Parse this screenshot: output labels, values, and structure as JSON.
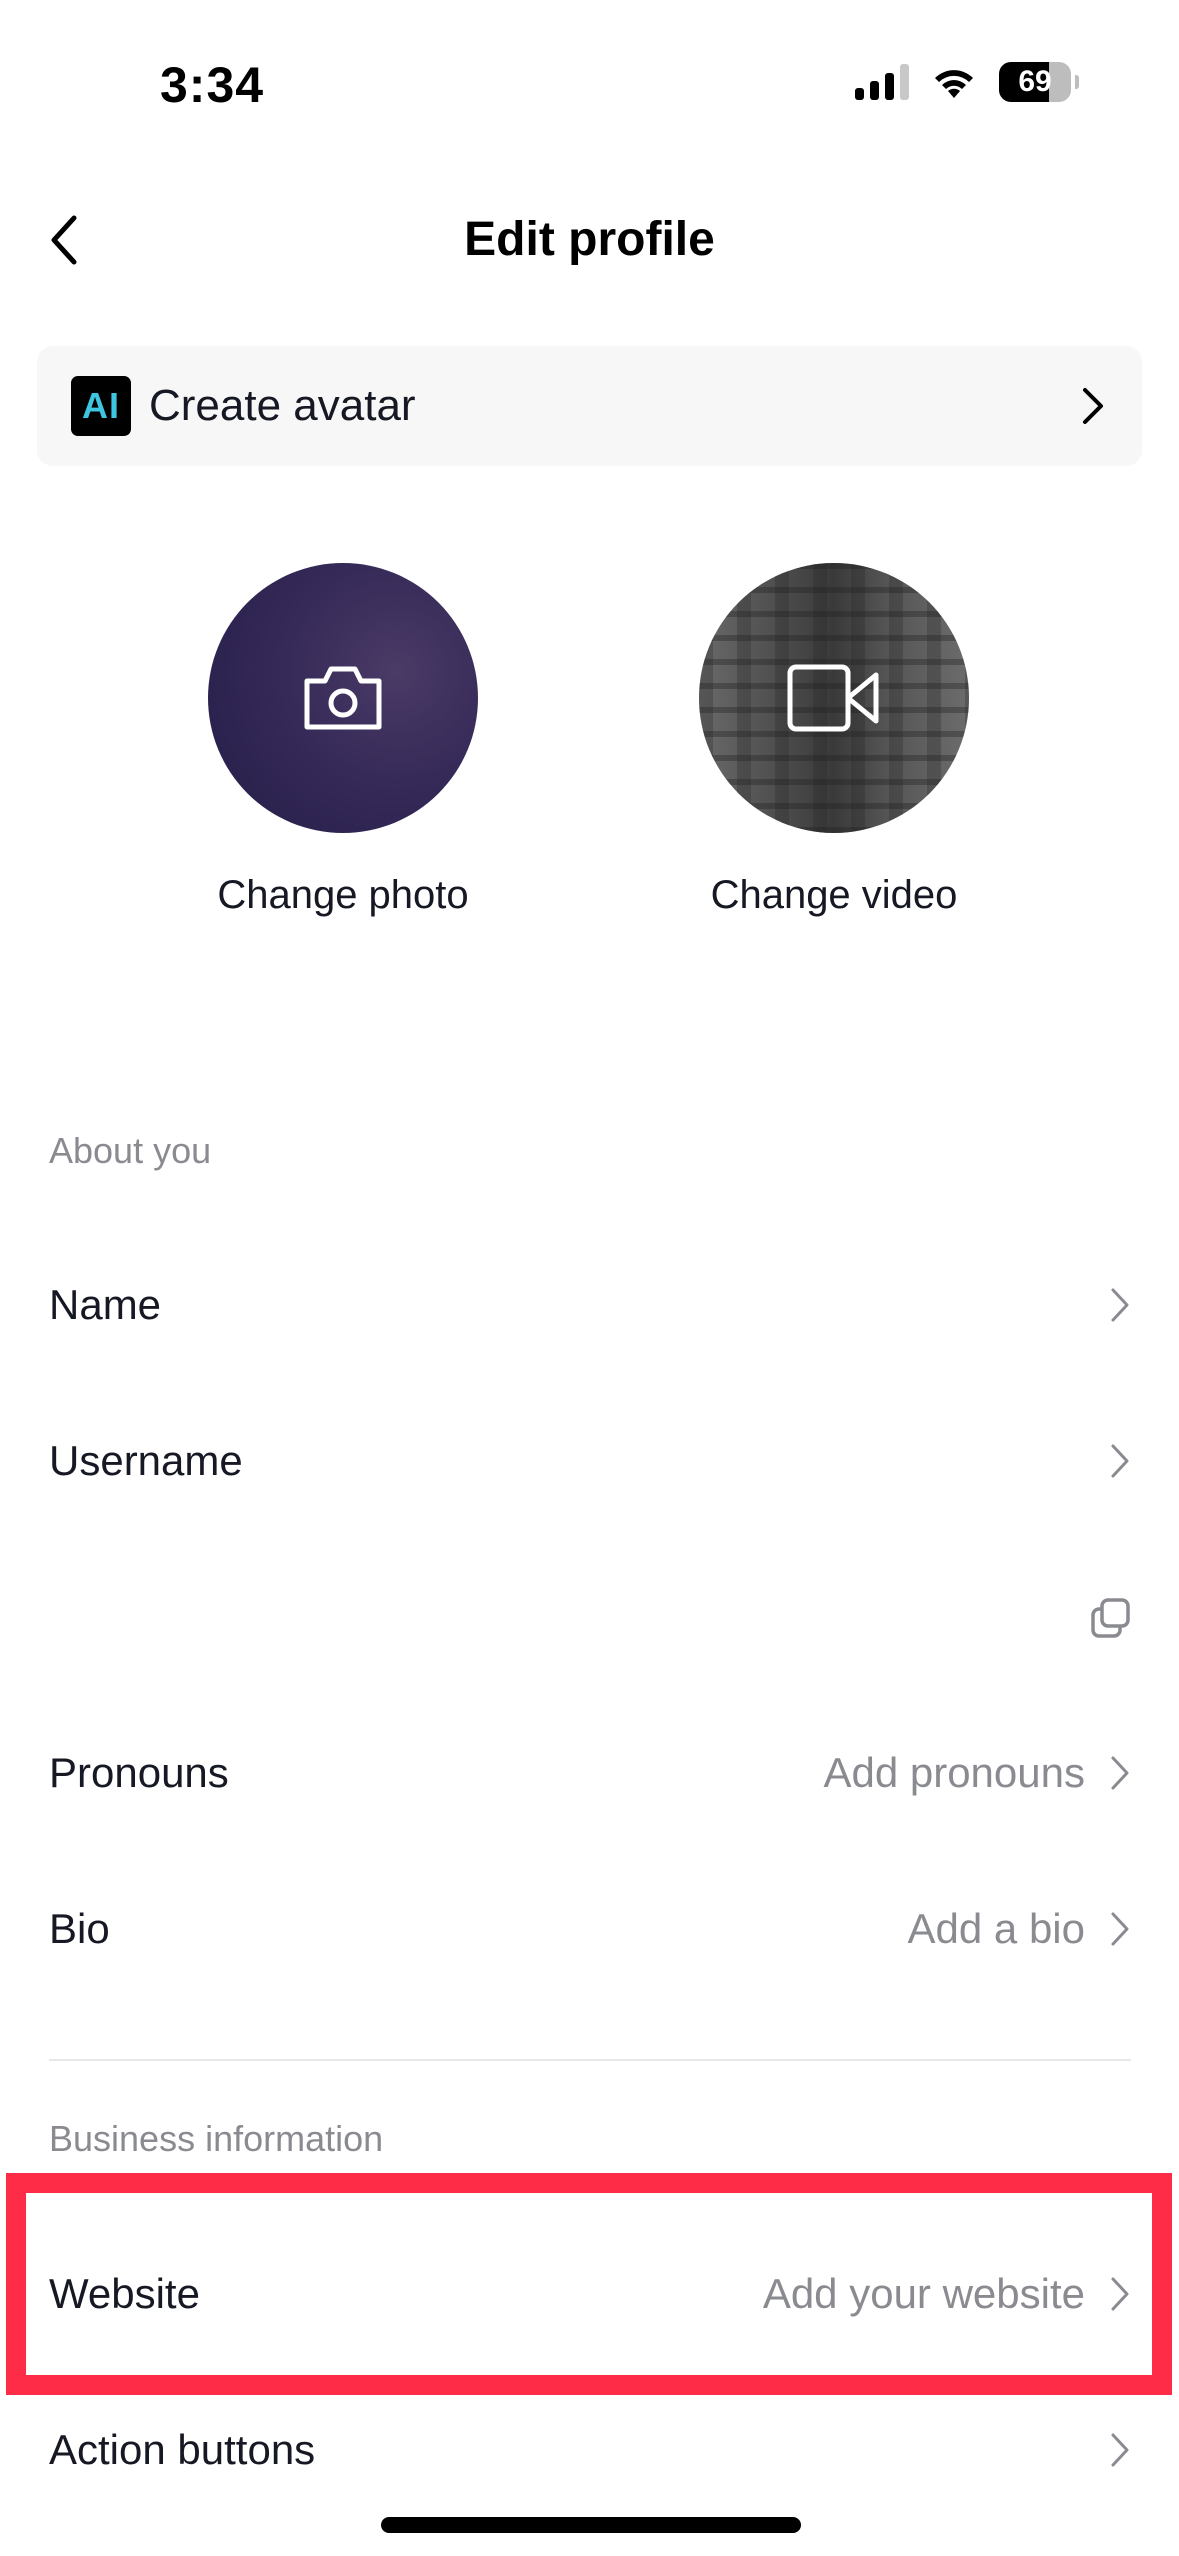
{
  "status_bar": {
    "time": "3:34",
    "battery_percent": "69",
    "battery_level": 0.69,
    "icons": [
      "cellular-signal-icon",
      "wifi-icon",
      "battery-icon"
    ]
  },
  "nav": {
    "title": "Edit profile",
    "back_icon": "chevron-left-icon"
  },
  "avatar_card": {
    "badge": "AI",
    "label": "Create avatar",
    "icon": "chevron-right-icon"
  },
  "media": {
    "photo_label": "Change photo",
    "video_label": "Change video",
    "photo_icon": "camera-icon",
    "video_icon": "video-camera-icon"
  },
  "about": {
    "header": "About you",
    "rows": [
      {
        "label": "Name",
        "value": ""
      },
      {
        "label": "Username",
        "value": ""
      },
      {
        "label": "",
        "value": ""
      },
      {
        "label": "Pronouns",
        "value": "Add pronouns"
      },
      {
        "label": "Bio",
        "value": "Add a bio"
      }
    ]
  },
  "business": {
    "header": "Business information",
    "rows": [
      {
        "label": "Website",
        "value": "Add your website"
      },
      {
        "label": "Action buttons",
        "value": ""
      }
    ]
  },
  "colors": {
    "highlight": "#fe2c46",
    "ai_accent": "#3ec6e0",
    "secondary_text": "#8a8b91",
    "primary_text": "#161823"
  }
}
